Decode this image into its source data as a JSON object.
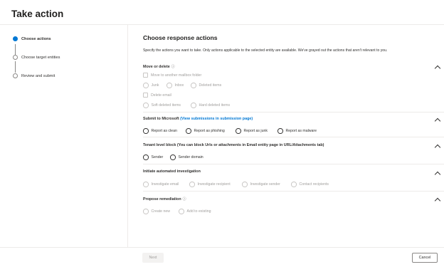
{
  "page": {
    "title": "Take action"
  },
  "steps": [
    {
      "label": "Choose actions",
      "active": true
    },
    {
      "label": "Choose target entities",
      "active": false
    },
    {
      "label": "Review and submit",
      "active": false
    }
  ],
  "main": {
    "title": "Choose response actions",
    "description": "Specify the actions you want to take. Only actions applicable to the selected entity are available. We've grayed out the actions that aren't relevant to you."
  },
  "sections": {
    "move_delete": {
      "title": "Move or delete",
      "info_icon": "info-icon",
      "options": {
        "move_mailbox": "Move to another mailbox folder",
        "junk": "Junk",
        "inbox": "Inbox",
        "deleted_items": "Deleted items",
        "delete_email": "Delete email",
        "soft_deleted": "Soft deleted items",
        "hard_deleted": "Hard deleted items"
      }
    },
    "submit": {
      "title": "Submit to Microsoft",
      "link": "(View submissions in submission page)",
      "options": {
        "clean": "Report as clean",
        "phishing": "Report as phishing",
        "junk": "Report as junk",
        "malware": "Report as malware"
      }
    },
    "block": {
      "title": "Tenant level block (You can block Urls or attachments in Email entity page in URL/Attachments tab)",
      "options": {
        "sender": "Sender",
        "sender_domain": "Sender domain"
      }
    },
    "investigation": {
      "title": "Initiate automated investigation",
      "options": {
        "email": "Investigate email",
        "recipient": "Investigate recipient",
        "sender": "Investigate sender",
        "contact": "Contact recipients"
      }
    },
    "remediation": {
      "title": "Propose remediation",
      "info_icon": "info-icon",
      "options": {
        "create_new": "Create new",
        "add_existing": "Add to existing"
      }
    }
  },
  "footer": {
    "next_label": "Next",
    "cancel_label": "Cancel"
  }
}
